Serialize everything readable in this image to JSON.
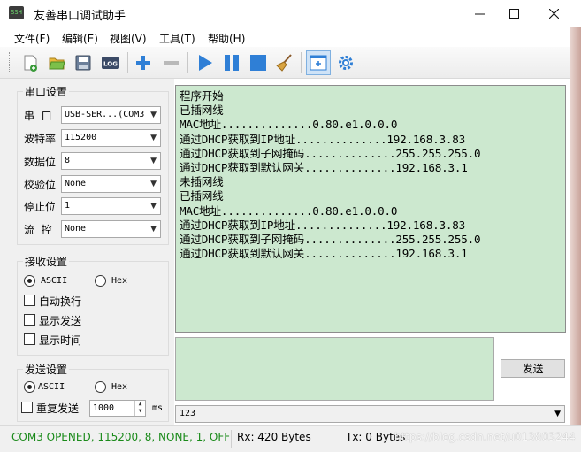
{
  "window": {
    "title": "友善串口调试助手",
    "app_icon_text": "SSH"
  },
  "menu": [
    "文件(F)",
    "编辑(E)",
    "视图(V)",
    "工具(T)",
    "帮助(H)"
  ],
  "toolbar": {
    "buttons": [
      "new-icon",
      "open-icon",
      "save-icon",
      "log-icon",
      "add-icon",
      "remove-icon",
      "play-icon",
      "pause-icon",
      "stop-icon",
      "broom-icon",
      "window-add-icon",
      "settings-gear-icon"
    ],
    "log_label": "LOG",
    "accent": "#2f7fd6"
  },
  "serial_settings": {
    "title": "串口设置",
    "port": {
      "label": "串  口",
      "value": "USB-SER...(COM3"
    },
    "baud": {
      "label": "波特率",
      "value": "115200"
    },
    "data_bits": {
      "label": "数据位",
      "value": "8"
    },
    "parity": {
      "label": "校验位",
      "value": "None"
    },
    "stop_bits": {
      "label": "停止位",
      "value": "1"
    },
    "flow": {
      "label": "流  控",
      "value": "None"
    }
  },
  "receive_settings": {
    "title": "接收设置",
    "ascii": "ASCII",
    "hex": "Hex",
    "auto_wrap": "自动换行",
    "show_send": "显示发送",
    "show_time": "显示时间"
  },
  "send_settings": {
    "title": "发送设置",
    "ascii": "ASCII",
    "hex": "Hex",
    "repeat": "重复发送",
    "interval": "1000",
    "unit": "ms"
  },
  "receive_lines": [
    "程序开始",
    "已插网线",
    "MAC地址..............0.80.e1.0.0.0",
    "通过DHCP获取到IP地址..............192.168.3.83",
    "通过DHCP获取到子网掩码..............255.255.255.0",
    "通过DHCP获取到默认网关..............192.168.3.1",
    "未插网线",
    "已插网线",
    "MAC地址..............0.80.e1.0.0.0",
    "通过DHCP获取到IP地址..............192.168.3.83",
    "通过DHCP获取到子网掩码..............255.255.255.0",
    "通过DHCP获取到默认网关..............192.168.3.1"
  ],
  "send": {
    "button": "发送",
    "history_value": "123"
  },
  "status": {
    "port_state": "COM3 OPENED, 115200, 8, NONE, 1, OFF",
    "rx": "Rx: 420 Bytes",
    "tx": "Tx: 0 Bytes",
    "watermark": "https://blog.csdn.net/u013803244",
    "port_state_color": "#1a8a1a"
  }
}
